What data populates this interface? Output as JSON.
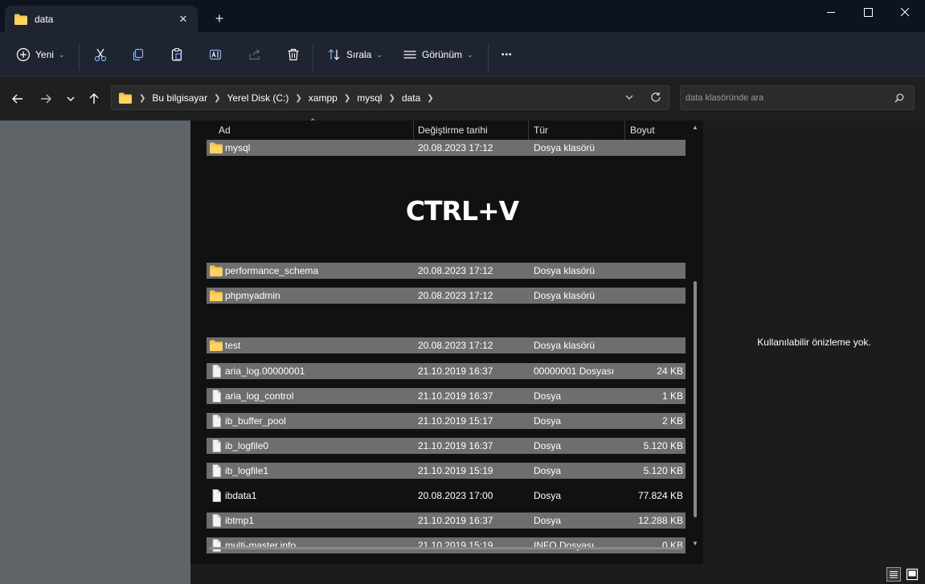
{
  "window": {
    "tab_title": "data",
    "close_tab_glyph": "✕",
    "new_tab_glyph": "+",
    "controls": [
      "minimize",
      "maximize",
      "close"
    ]
  },
  "toolbar": {
    "new_label": "Yeni",
    "sort_label": "Sırala",
    "view_label": "Görünüm",
    "more_glyph": "•••",
    "icons": [
      "plus-circle-icon",
      "cut-icon",
      "copy-icon",
      "paste-icon",
      "rename-icon",
      "share-icon",
      "delete-icon",
      "sort-icon",
      "view-icon",
      "more-icon"
    ]
  },
  "address": {
    "breadcrumbs": [
      "Bu bilgisayar",
      "Yerel Disk (C:)",
      "xampp",
      "mysql",
      "data"
    ],
    "search_placeholder": "data klasöründe ara"
  },
  "columns": {
    "name": "Ad",
    "date": "Değiştirme tarihi",
    "type": "Tür",
    "size": "Boyut"
  },
  "overlay_text": "CTRL+V",
  "files": [
    {
      "name": "mysql",
      "date": "20.08.2023 17:12",
      "type": "Dosya klasörü",
      "size": "",
      "icon": "folder-icon",
      "highlighted": true
    },
    {
      "name": "performance_schema",
      "date": "20.08.2023 17:12",
      "type": "Dosya klasörü",
      "size": "",
      "icon": "folder-icon",
      "highlighted": true
    },
    {
      "name": "phpmyadmin",
      "date": "20.08.2023 17:12",
      "type": "Dosya klasörü",
      "size": "",
      "icon": "folder-icon",
      "highlighted": true
    },
    {
      "name": "test",
      "date": "20.08.2023 17:12",
      "type": "Dosya klasörü",
      "size": "",
      "icon": "folder-icon",
      "highlighted": true
    },
    {
      "name": "aria_log.00000001",
      "date": "21.10.2019 16:37",
      "type": "00000001 Dosyası",
      "size": "24 KB",
      "icon": "file-icon",
      "highlighted": true
    },
    {
      "name": "aria_log_control",
      "date": "21.10.2019 16:37",
      "type": "Dosya",
      "size": "1 KB",
      "icon": "file-icon",
      "highlighted": true
    },
    {
      "name": "ib_buffer_pool",
      "date": "21.10.2019 15:17",
      "type": "Dosya",
      "size": "2 KB",
      "icon": "file-icon",
      "highlighted": true
    },
    {
      "name": "ib_logfile0",
      "date": "21.10.2019 16:37",
      "type": "Dosya",
      "size": "5.120 KB",
      "icon": "file-icon",
      "highlighted": true
    },
    {
      "name": "ib_logfile1",
      "date": "21.10.2019 15:19",
      "type": "Dosya",
      "size": "5.120 KB",
      "icon": "file-icon",
      "highlighted": true
    },
    {
      "name": "ibdata1",
      "date": "20.08.2023 17:00",
      "type": "Dosya",
      "size": "77.824 KB",
      "icon": "file-icon",
      "highlighted": false
    },
    {
      "name": "ibtmp1",
      "date": "21.10.2019 16:37",
      "type": "Dosya",
      "size": "12.288 KB",
      "icon": "file-icon",
      "highlighted": true
    },
    {
      "name": "multi-master.info",
      "date": "21.10.2019 15:19",
      "type": "INFO Dosyası",
      "size": "0 KB",
      "icon": "file-icon",
      "highlighted": true
    }
  ],
  "preview": {
    "message": "Kullanılabilir önizleme yok."
  },
  "colors": {
    "folder": "#f5c451",
    "row_highlight": "#6e6e6e",
    "nav_pane": "#5f6468"
  }
}
